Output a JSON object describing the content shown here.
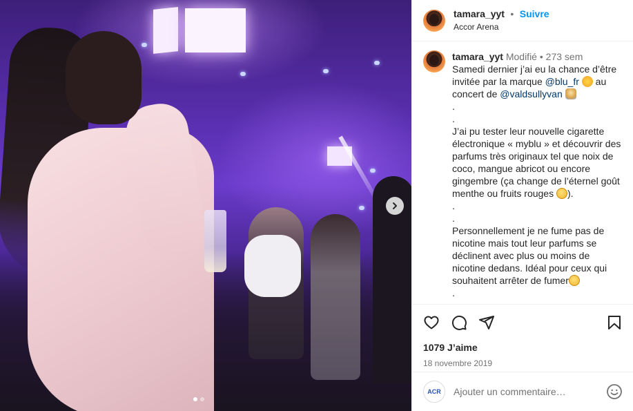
{
  "post": {
    "username": "tamara_yyt",
    "follow_label": "Suivre",
    "separator": "•",
    "location": "Accor Arena"
  },
  "caption": {
    "username": "tamara_yyt",
    "edited": "Modifié",
    "separator": "•",
    "age": "273 sem",
    "lines": {
      "l1": "Samedi dernier j’ai eu la chance d’être",
      "l2a": "invitée par la marque ",
      "mention1": "@blu_fr",
      "l2b": " au",
      "l3a": "concert de ",
      "mention2": "@valdsullyvan",
      "dot": ".",
      "p2_1": "J’ai pu tester leur nouvelle cigarette",
      "p2_2": "électronique « myblu » et découvrir des",
      "p2_3": "parfums très originaux tel que noix de",
      "p2_4": "coco, mangue abricot ou encore",
      "p2_5": "gingembre (ça change de l’éternel goût",
      "p2_6": "menthe ou fruits rouges ",
      "p2_6b": ").",
      "p3_1": "Personnellement je ne fume pas de",
      "p3_2": "nicotine mais tout leur parfums se",
      "p3_3": "déclinent avec plus ou moins de",
      "p3_4": "nicotine dedans. Idéal pour ceux qui",
      "p3_5": "souhaitent arrêter de fumer"
    }
  },
  "stats": {
    "likes": "1079 J’aime",
    "date": "18 novembre 2019"
  },
  "add_comment": {
    "placeholder": "Ajouter un commentaire…",
    "avatar_text": "ACR"
  },
  "icons": {
    "like": "heart-icon",
    "comment": "comment-icon",
    "share": "send-icon",
    "save": "bookmark-icon",
    "next": "chevron-right-icon",
    "emoji": "smiley-icon"
  },
  "carousel": {
    "slides": 2,
    "active": 1
  },
  "colors": {
    "accent": "#0095f6",
    "mention": "#00376b",
    "muted": "#737373"
  }
}
